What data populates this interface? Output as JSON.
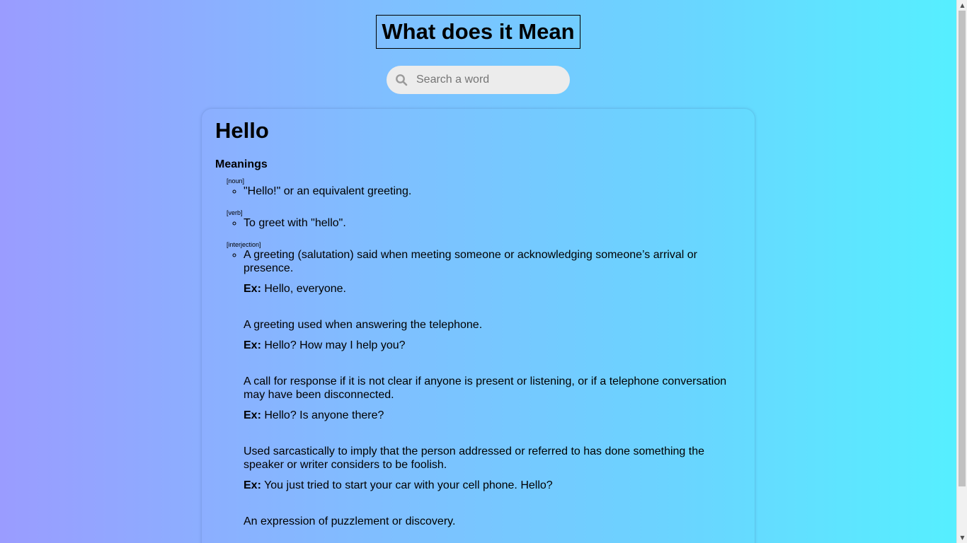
{
  "header": {
    "title": "What does it Mean"
  },
  "search": {
    "placeholder": "Search a word",
    "icon": "search-icon"
  },
  "result": {
    "word": "Hello",
    "meanings_heading": "Meanings",
    "example_prefix": "Ex:",
    "groups": [
      {
        "pos": "[noun]",
        "definitions": [
          {
            "text": "\"Hello!\" or an equivalent greeting.",
            "example": ""
          }
        ]
      },
      {
        "pos": "[verb]",
        "definitions": [
          {
            "text": "To greet with \"hello\".",
            "example": ""
          }
        ]
      },
      {
        "pos": "[interjection]",
        "definitions": [
          {
            "text": "A greeting (salutation) said when meeting someone or acknowledging someone’s arrival or presence.",
            "example": "Hello, everyone."
          },
          {
            "text": "A greeting used when answering the telephone.",
            "example": "Hello? How may I help you?"
          },
          {
            "text": "A call for response if it is not clear if anyone is present or listening, or if a telephone conversation may have been disconnected.",
            "example": "Hello? Is anyone there?"
          },
          {
            "text": "Used sarcastically to imply that the person addressed or referred to has done something the speaker or writer considers to be foolish.",
            "example": "You just tried to start your car with your cell phone. Hello?"
          },
          {
            "text": "An expression of puzzlement or discovery.",
            "example": ""
          }
        ]
      }
    ]
  }
}
